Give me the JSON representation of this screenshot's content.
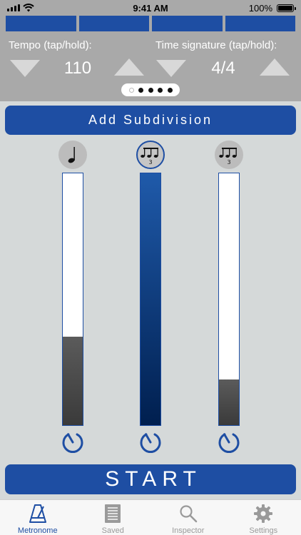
{
  "status_bar": {
    "time": "9:41 AM",
    "battery": "100%"
  },
  "beats": {
    "count": 4
  },
  "tempo": {
    "label": "Tempo (tap/hold):",
    "value": "110"
  },
  "time_signature": {
    "label": "Time signature (tap/hold):",
    "value": "4/4"
  },
  "pager": {
    "pages": 5,
    "current": 1
  },
  "add_subdivision": {
    "label": "Add Subdivision"
  },
  "subdivisions": [
    {
      "icon": "quarter-note-icon",
      "level": 0.35,
      "active": false
    },
    {
      "icon": "triplet-eighth-notes-icon",
      "level": 1.0,
      "active": true
    },
    {
      "icon": "triplet-eighth-notes-icon",
      "level": 0.18,
      "active": false
    }
  ],
  "start": {
    "label": "START"
  },
  "tabs": [
    {
      "label": "Metronome",
      "icon": "metronome-icon",
      "active": true
    },
    {
      "label": "Saved",
      "icon": "document-list-icon",
      "active": false
    },
    {
      "label": "Inspector",
      "icon": "magnifier-icon",
      "active": false
    },
    {
      "label": "Settings",
      "icon": "gear-icon",
      "active": false
    }
  ],
  "colors": {
    "accent": "#1e4ea3",
    "header_bg": "#a9a9a9",
    "body_bg": "#d5d9d9"
  }
}
